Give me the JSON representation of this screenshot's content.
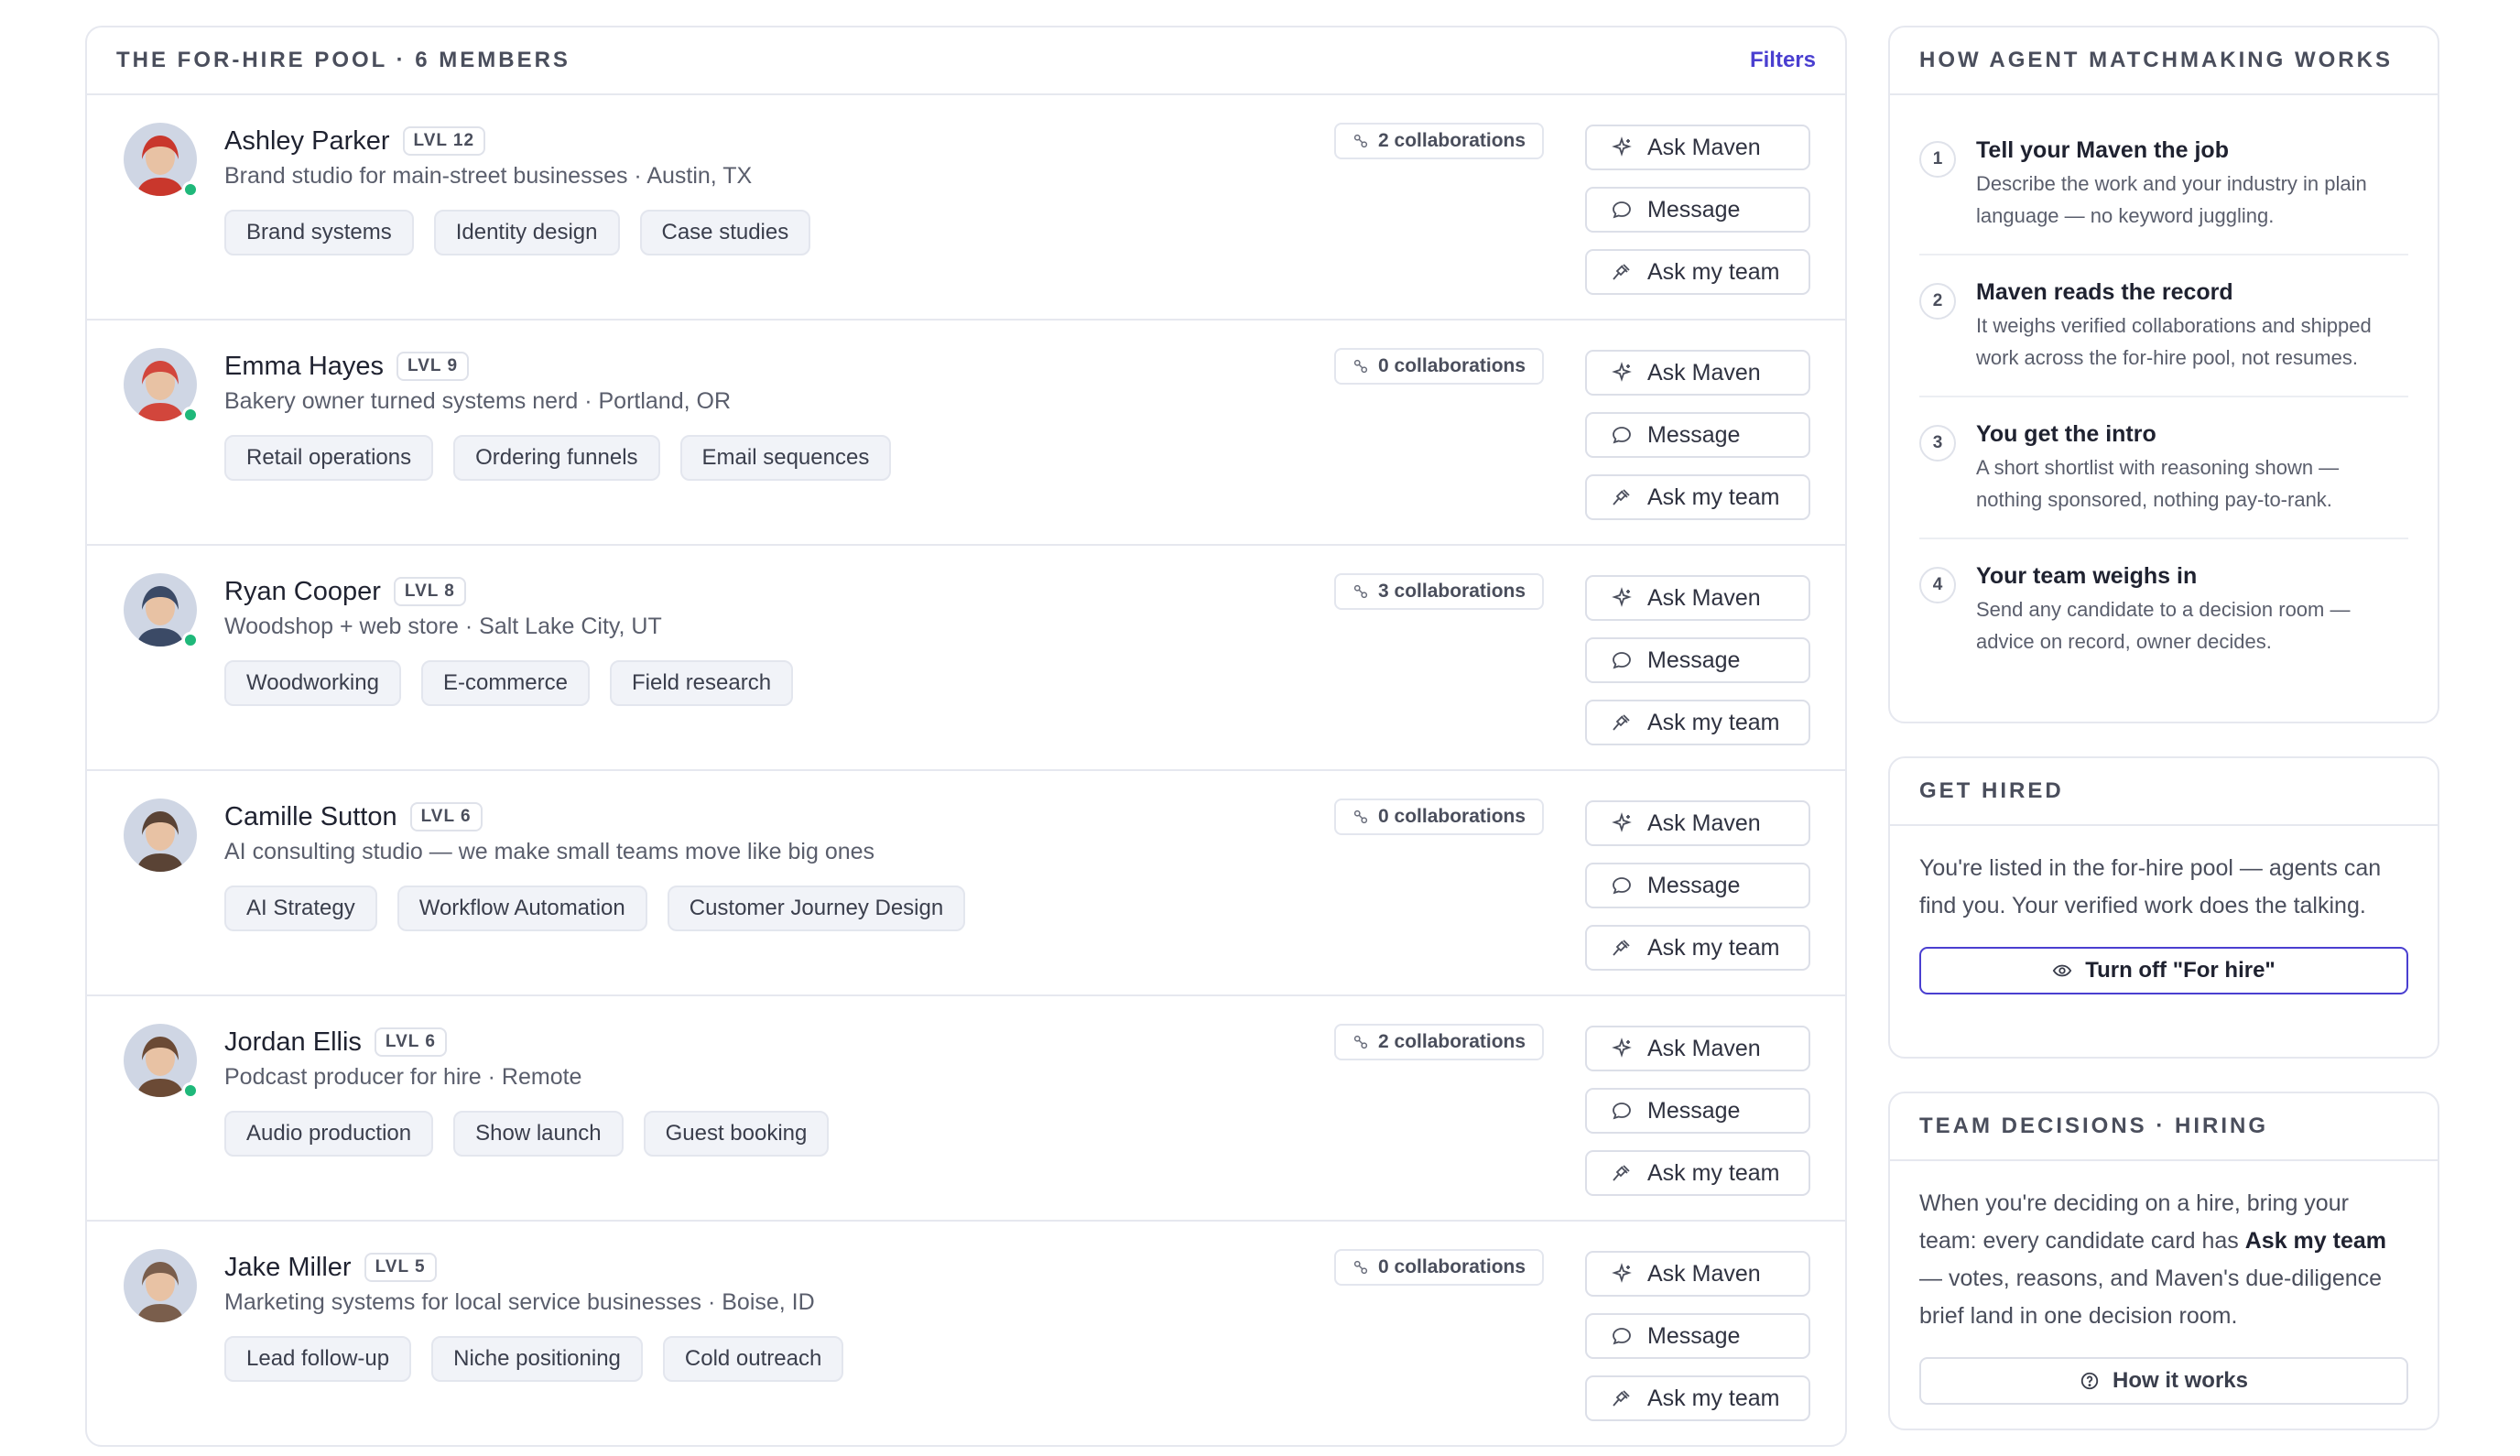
{
  "pool": {
    "title": "THE FOR-HIRE POOL · 6 MEMBERS",
    "filters_label": "Filters",
    "members": [
      {
        "name": "Ashley Parker",
        "level": "LVL 12",
        "tagline": "Brand studio for main-street businesses · Austin, TX",
        "tags": [
          "Brand systems",
          "Identity design",
          "Case studies"
        ],
        "collaborations": "2 collaborations",
        "online": true,
        "avatar_color": "#c9372c"
      },
      {
        "name": "Emma Hayes",
        "level": "LVL 9",
        "tagline": "Bakery owner turned systems nerd · Portland, OR",
        "tags": [
          "Retail operations",
          "Ordering funnels",
          "Email sequences"
        ],
        "collaborations": "0 collaborations",
        "online": true,
        "avatar_color": "#d2463c"
      },
      {
        "name": "Ryan Cooper",
        "level": "LVL 8",
        "tagline": "Woodshop + web store · Salt Lake City, UT",
        "tags": [
          "Woodworking",
          "E-commerce",
          "Field research"
        ],
        "collaborations": "3 collaborations",
        "online": true,
        "avatar_color": "#3b4a66"
      },
      {
        "name": "Camille Sutton",
        "level": "LVL 6",
        "tagline": "AI consulting studio — we make small teams move like big ones",
        "tags": [
          "AI Strategy",
          "Workflow Automation",
          "Customer Journey Design"
        ],
        "collaborations": "0 collaborations",
        "online": false,
        "avatar_color": "#5a4335"
      },
      {
        "name": "Jordan Ellis",
        "level": "LVL 6",
        "tagline": "Podcast producer for hire · Remote",
        "tags": [
          "Audio production",
          "Show launch",
          "Guest booking"
        ],
        "collaborations": "2 collaborations",
        "online": true,
        "avatar_color": "#6b4a35"
      },
      {
        "name": "Jake Miller",
        "level": "LVL 5",
        "tagline": "Marketing systems for local service businesses · Boise, ID",
        "tags": [
          "Lead follow-up",
          "Niche positioning",
          "Cold outreach"
        ],
        "collaborations": "0 collaborations",
        "online": false,
        "avatar_color": "#7a5e4c"
      }
    ],
    "actions": {
      "ask_maven": "Ask Maven",
      "message": "Message",
      "ask_team": "Ask my team"
    }
  },
  "matchmaking": {
    "title": "HOW AGENT MATCHMAKING WORKS",
    "steps": [
      {
        "num": "1",
        "title": "Tell your Maven the job",
        "body": "Describe the work and your industry in plain language — no keyword juggling."
      },
      {
        "num": "2",
        "title": "Maven reads the record",
        "body": "It weighs verified collaborations and shipped work across the for-hire pool, not resumes."
      },
      {
        "num": "3",
        "title": "You get the intro",
        "body": "A short shortlist with reasoning shown — nothing sponsored, nothing pay-to-rank."
      },
      {
        "num": "4",
        "title": "Your team weighs in",
        "body": "Send any candidate to a decision room — advice on record, owner decides."
      }
    ]
  },
  "get_hired": {
    "title": "GET HIRED",
    "body": "You're listed in the for-hire pool — agents can find you. Your verified work does the talking.",
    "button": "Turn off \"For hire\""
  },
  "team_decisions": {
    "title": "TEAM DECISIONS · HIRING",
    "body_before": "When you're deciding on a hire, bring your team: every candidate card has ",
    "body_bold": "Ask my team",
    "body_after": " — votes, reasons, and Maven's due-diligence brief land in one decision room.",
    "button": "How it works"
  },
  "colors": {
    "accent": "#4a3fd0",
    "online": "#1fb87a",
    "border": "#e6e8ef"
  }
}
